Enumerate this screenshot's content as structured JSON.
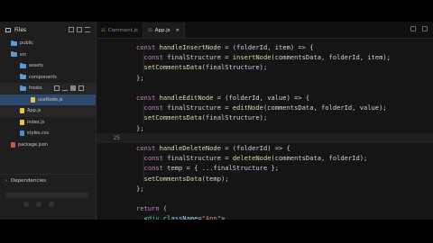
{
  "sidebar": {
    "title": "Files",
    "items": [
      {
        "label": "public",
        "type": "folder"
      },
      {
        "label": "src",
        "type": "folder"
      },
      {
        "label": "assets",
        "type": "folder"
      },
      {
        "label": "components",
        "type": "folder"
      },
      {
        "label": "hooks",
        "type": "folder"
      },
      {
        "label": "useNode.js",
        "type": "js"
      },
      {
        "label": "App.js",
        "type": "js"
      },
      {
        "label": "index.js",
        "type": "js"
      },
      {
        "label": "styles.css",
        "type": "css"
      },
      {
        "label": "package.json",
        "type": "json"
      }
    ],
    "dependencies_label": "Dependencies"
  },
  "tabs": [
    {
      "label": "Comment.js",
      "icon": "js",
      "active": false
    },
    {
      "label": "App.js",
      "icon": "js",
      "active": true
    }
  ],
  "editor": {
    "current_line": "25",
    "lines": [
      {
        "num": "",
        "tokens": [
          [
            "kw",
            "const "
          ],
          [
            "fn",
            "handleInsertNode"
          ],
          [
            "pl",
            " = (folderId, item) => {"
          ]
        ]
      },
      {
        "num": "",
        "tokens": [
          [
            "pl",
            "  "
          ],
          [
            "kw",
            "const "
          ],
          [
            "pl",
            "finalStructure = "
          ],
          [
            "fn",
            "insertNode"
          ],
          [
            "pl",
            "(commentsData, folderId, item);"
          ]
        ]
      },
      {
        "num": "",
        "tokens": [
          [
            "pl",
            "  "
          ],
          [
            "fn",
            "setCommentsData"
          ],
          [
            "pl",
            "(finalStructure);"
          ]
        ]
      },
      {
        "num": "",
        "tokens": [
          [
            "pl",
            "};"
          ]
        ]
      },
      {
        "num": "",
        "tokens": []
      },
      {
        "num": "",
        "tokens": [
          [
            "kw",
            "const "
          ],
          [
            "fn",
            "handleEditNode"
          ],
          [
            "pl",
            " = (folderId, value) => {"
          ]
        ]
      },
      {
        "num": "",
        "tokens": [
          [
            "pl",
            "  "
          ],
          [
            "kw",
            "const "
          ],
          [
            "pl",
            "finalStructure = "
          ],
          [
            "fn",
            "editNode"
          ],
          [
            "pl",
            "(commentsData, folderId, value);"
          ]
        ]
      },
      {
        "num": "",
        "tokens": [
          [
            "pl",
            "  "
          ],
          [
            "fn",
            "setCommentsData"
          ],
          [
            "pl",
            "(finalStructure);"
          ]
        ]
      },
      {
        "num": "",
        "tokens": [
          [
            "pl",
            "};"
          ]
        ]
      },
      {
        "num": "25",
        "tokens": []
      },
      {
        "num": "",
        "tokens": [
          [
            "kw",
            "const "
          ],
          [
            "fn",
            "handleDeleteNode"
          ],
          [
            "pl",
            " = (folderId) => {"
          ]
        ]
      },
      {
        "num": "",
        "tokens": [
          [
            "pl",
            "  "
          ],
          [
            "kw",
            "const "
          ],
          [
            "pl",
            "finalStructure = "
          ],
          [
            "fn",
            "deleteNode"
          ],
          [
            "pl",
            "(commentsData, folderId);"
          ]
        ]
      },
      {
        "num": "",
        "tokens": [
          [
            "pl",
            "  "
          ],
          [
            "kw",
            "const "
          ],
          [
            "pl",
            "temp = { ...finalStructure };"
          ]
        ]
      },
      {
        "num": "",
        "tokens": [
          [
            "pl",
            "  "
          ],
          [
            "fn",
            "setCommentsData"
          ],
          [
            "pl",
            "(temp);"
          ]
        ]
      },
      {
        "num": "",
        "tokens": [
          [
            "pl",
            "};"
          ]
        ]
      },
      {
        "num": "",
        "tokens": []
      },
      {
        "num": "",
        "tokens": [
          [
            "kw",
            "return "
          ],
          [
            "pl",
            "("
          ]
        ]
      },
      {
        "num": "",
        "tokens": [
          [
            "pl",
            "  <"
          ],
          [
            "tg",
            "div "
          ],
          [
            "at",
            "className"
          ],
          [
            "pl",
            "="
          ],
          [
            "st",
            "\"App\""
          ],
          [
            "pl",
            ">"
          ]
        ]
      }
    ]
  }
}
